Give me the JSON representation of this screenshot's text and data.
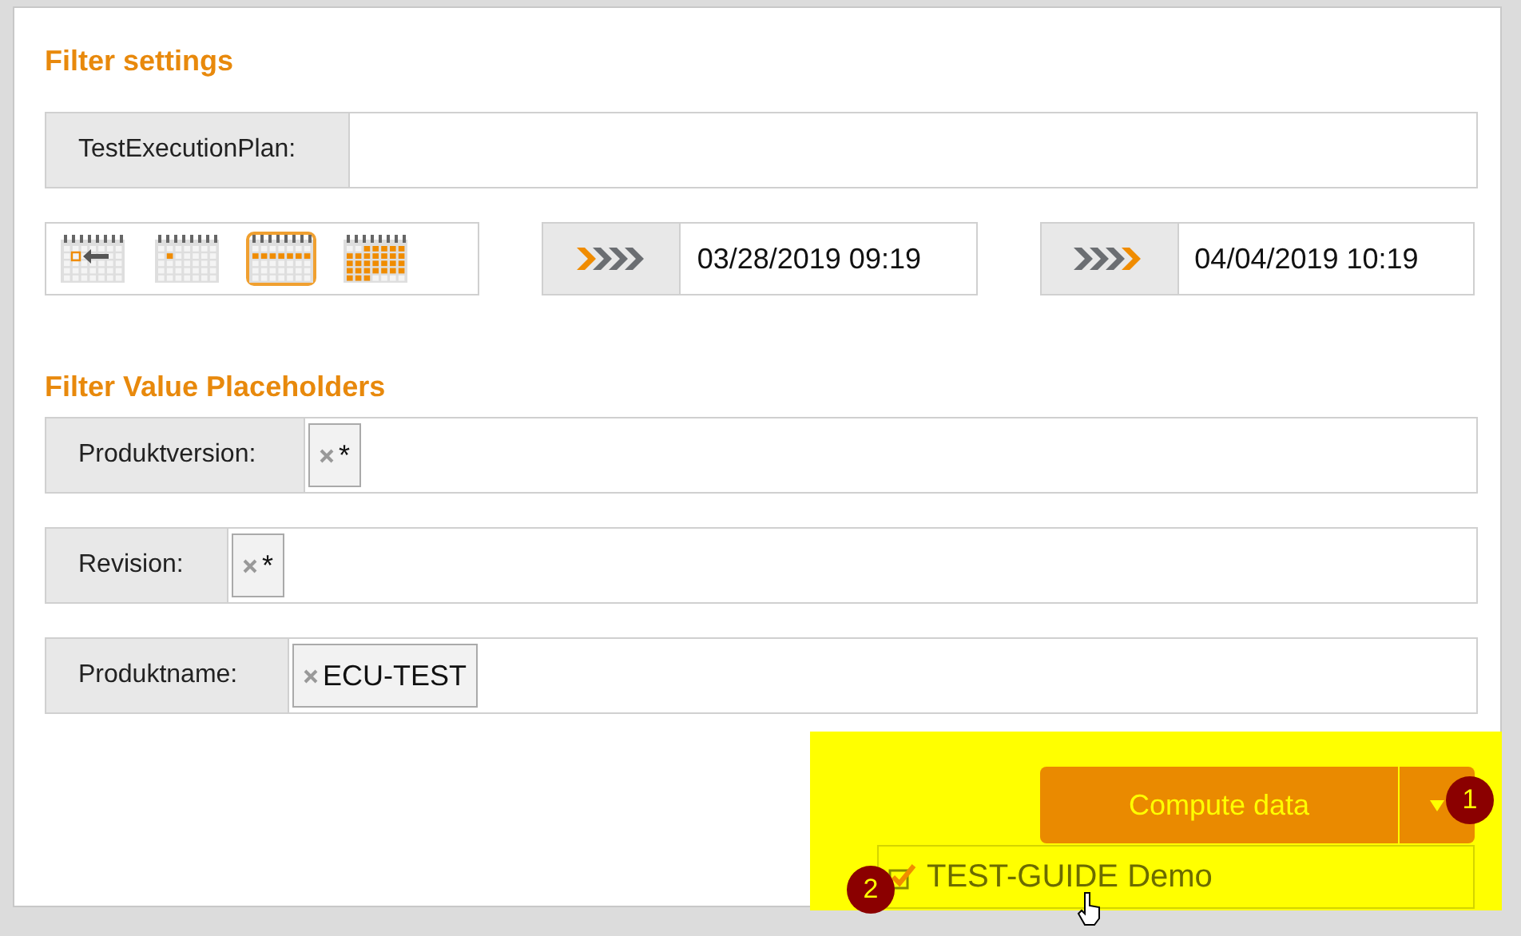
{
  "filter_settings": {
    "title": "Filter settings",
    "execution_plan": {
      "label": "TestExecutionPlan:"
    },
    "date_presets": [
      {
        "kind": "previous",
        "selected": false
      },
      {
        "kind": "day",
        "selected": false
      },
      {
        "kind": "week",
        "selected": true
      },
      {
        "kind": "month",
        "selected": false
      }
    ],
    "date_range": [
      {
        "kind": "from",
        "value": "03/28/2019 09:19"
      },
      {
        "kind": "to",
        "value": "04/04/2019 10:19"
      }
    ]
  },
  "placeholders": {
    "title": "Filter Value Placeholders",
    "rows": [
      {
        "label": "Produktversion:",
        "tags": [
          "*"
        ]
      },
      {
        "label": "Revision:",
        "tags": [
          "*"
        ]
      },
      {
        "label": "Produktname:",
        "tags": [
          "ECU-TEST"
        ]
      }
    ]
  },
  "actions": {
    "button": "Compute data",
    "menu_items": [
      {
        "label": "TEST-GUIDE Demo",
        "checked": true
      }
    ]
  },
  "annotations": [
    "1",
    "2"
  ]
}
